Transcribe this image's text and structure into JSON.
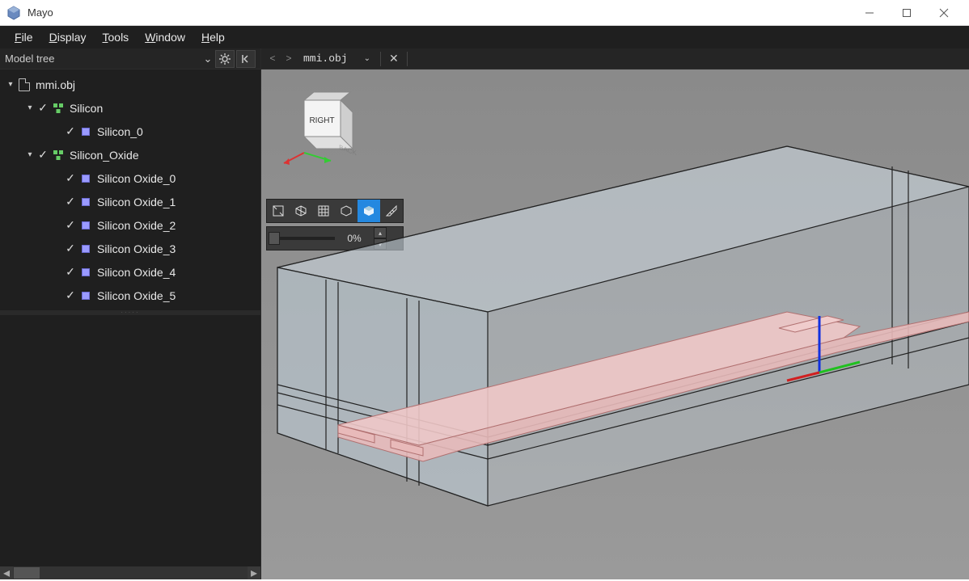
{
  "app": {
    "title": "Mayo"
  },
  "menubar": {
    "file": "File",
    "display": "Display",
    "tools": "Tools",
    "window": "Window",
    "help": "Help"
  },
  "sidebar": {
    "panel_title": "Model tree",
    "root": {
      "label": "mmi.obj"
    },
    "groups": [
      {
        "label": "Silicon",
        "children": [
          {
            "label": "Silicon_0"
          }
        ]
      },
      {
        "label": "Silicon_Oxide",
        "children": [
          {
            "label": "Silicon Oxide_0"
          },
          {
            "label": "Silicon Oxide_1"
          },
          {
            "label": "Silicon Oxide_2"
          },
          {
            "label": "Silicon Oxide_3"
          },
          {
            "label": "Silicon Oxide_4"
          },
          {
            "label": "Silicon Oxide_5"
          }
        ]
      }
    ]
  },
  "viewer": {
    "tab": "mmi.obj",
    "orientation_face": "RIGHT",
    "orientation_back": "BACK",
    "slider_pct": "0%"
  },
  "colors": {
    "accent": "#2488e0",
    "silicon": "#e8baba",
    "oxide": "#c8d5de"
  }
}
